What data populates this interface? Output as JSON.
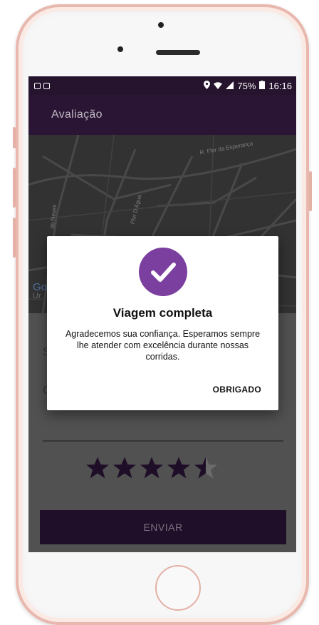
{
  "status_bar": {
    "battery": "75%",
    "time": "16:16"
  },
  "appbar": {
    "title": "Avaliação"
  },
  "map": {
    "streets": [
      "R. Flor da Esperança",
      "Flor D'Água",
      "do Neves"
    ],
    "provider": "Go",
    "provider_sub": "Ur"
  },
  "rating": {
    "value": 4.5,
    "max": 5
  },
  "send_button": {
    "label": "ENVIAR"
  },
  "dialog": {
    "title": "Viagem completa",
    "message": "Agradecemos sua confiança. Esperamos sempre lhe atender com excelência durante nossas corridas.",
    "ok_label": "OBRIGADO"
  },
  "colors": {
    "brand_dark": "#2a1634",
    "brand_accent": "#7b3fa0",
    "star": "#24112d"
  }
}
